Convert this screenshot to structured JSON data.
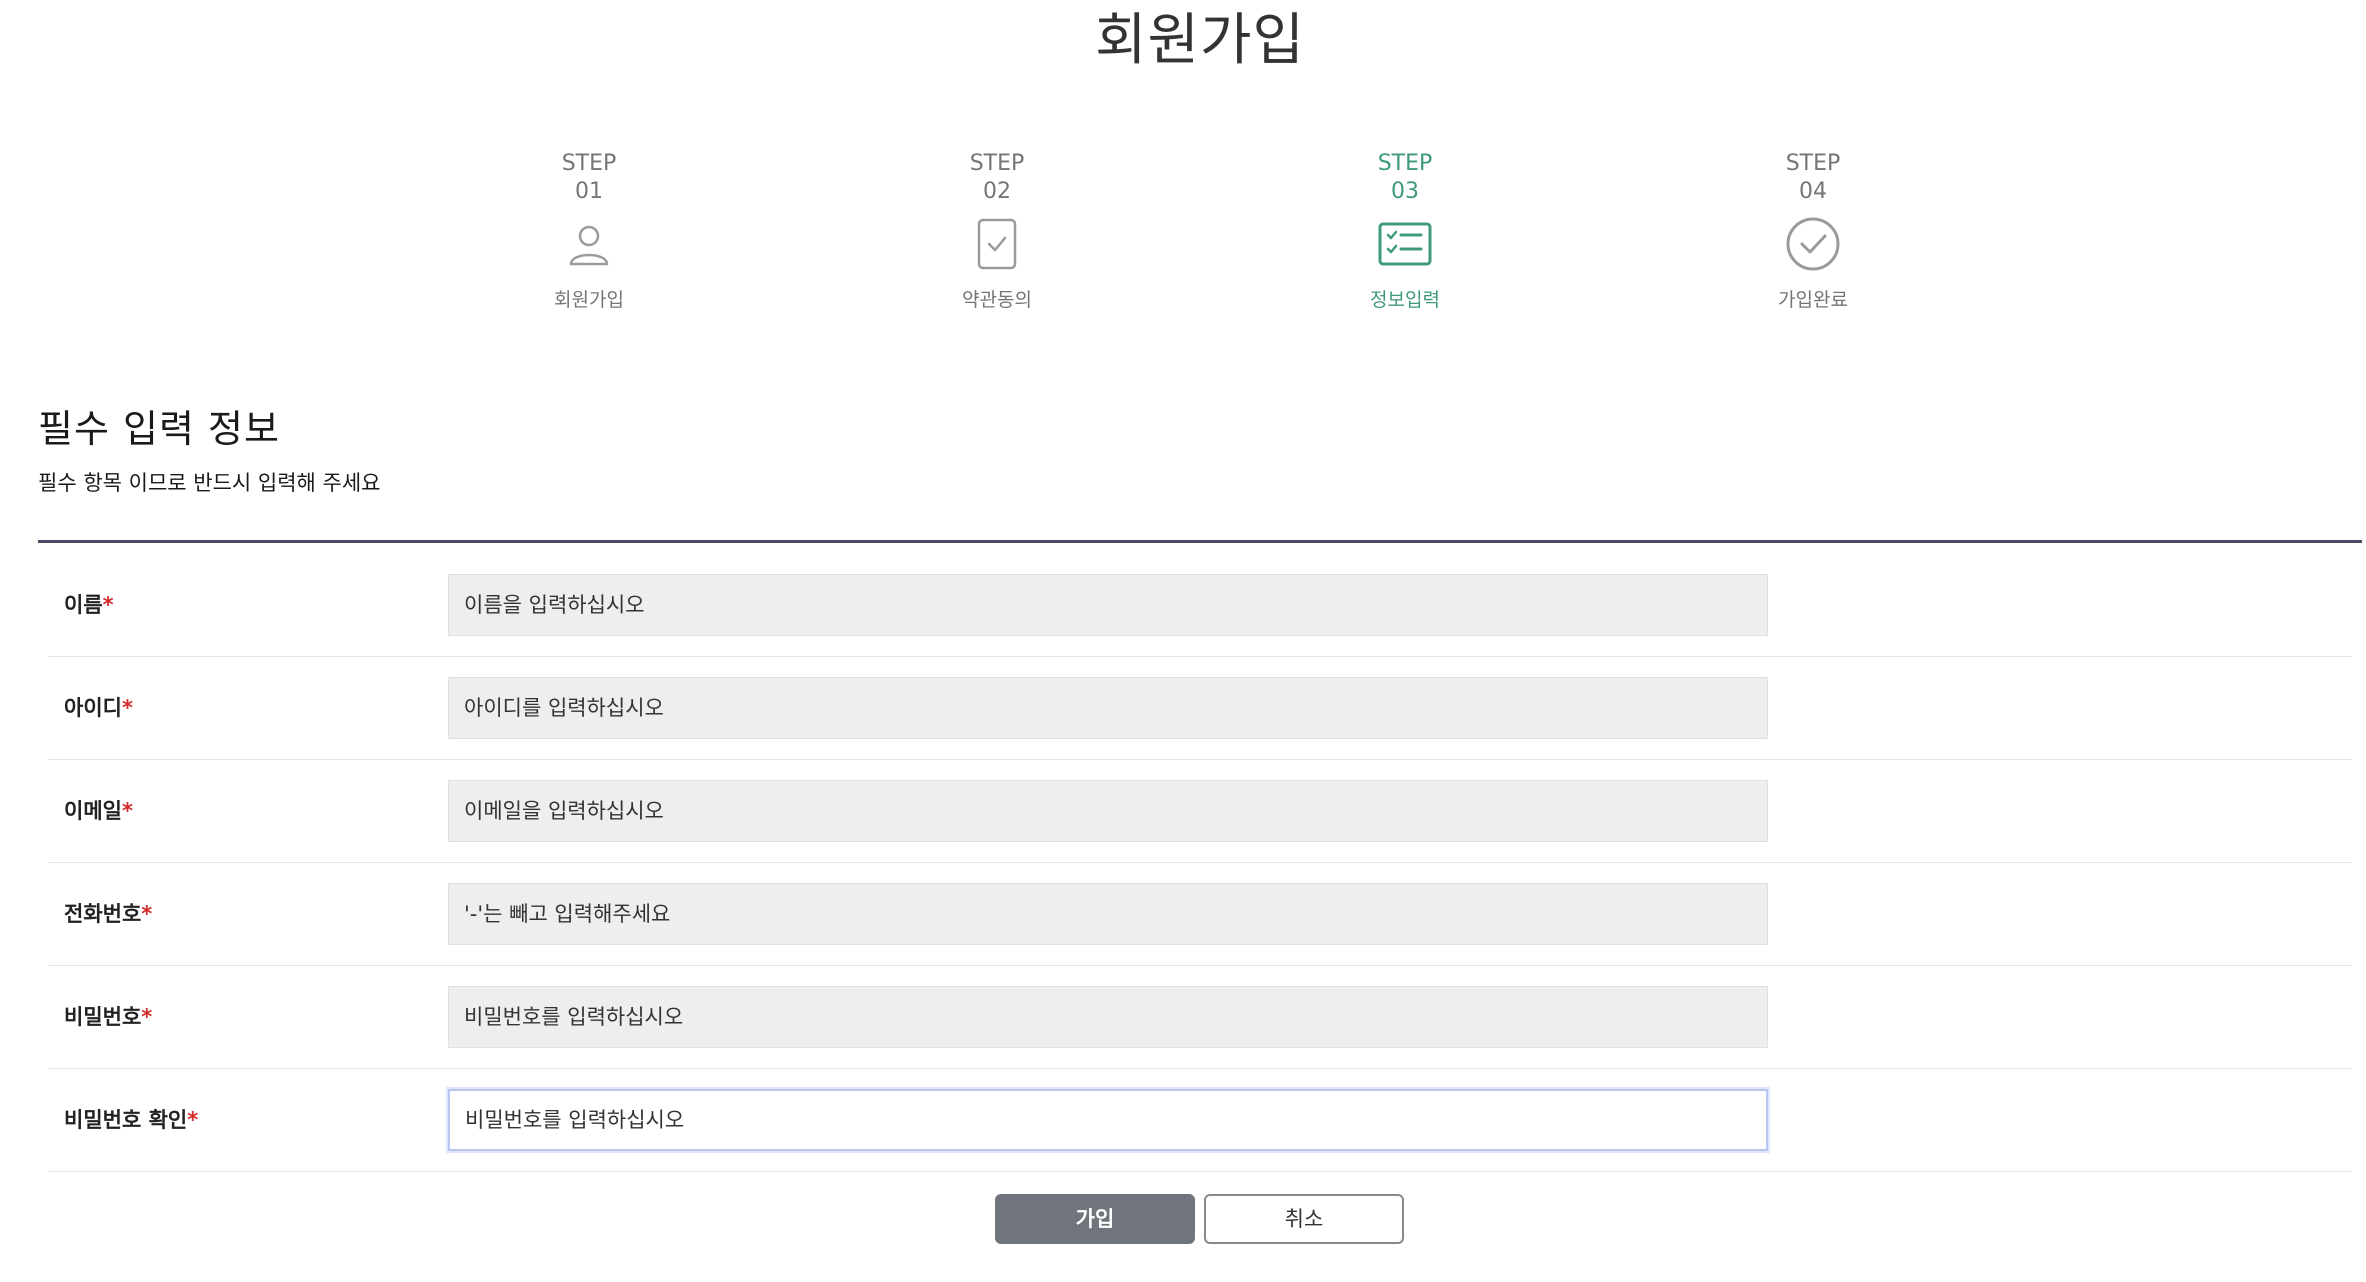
{
  "page": {
    "title": "회원가입"
  },
  "steps": [
    {
      "label": "STEP",
      "number": "01",
      "name": "회원가입",
      "icon": "person-icon",
      "active": false
    },
    {
      "label": "STEP",
      "number": "02",
      "name": "약관동의",
      "icon": "document-check-icon",
      "active": false
    },
    {
      "label": "STEP",
      "number": "03",
      "name": "정보입력",
      "icon": "checklist-form-icon",
      "active": true
    },
    {
      "label": "STEP",
      "number": "04",
      "name": "가입완료",
      "icon": "check-circle-icon",
      "active": false
    }
  ],
  "section": {
    "title": "필수 입력 정보",
    "description": "필수 항목 이므로 반드시 입력해 주세요"
  },
  "form": {
    "required_mark": "*",
    "fields": [
      {
        "label": "이름",
        "placeholder": "이름을 입력하십시오",
        "value": ""
      },
      {
        "label": "아이디",
        "placeholder": "아이디를 입력하십시오",
        "value": ""
      },
      {
        "label": "이메일",
        "placeholder": "이메일을 입력하십시오",
        "value": ""
      },
      {
        "label": "전화번호",
        "placeholder": "'-'는 빼고 입력해주세요",
        "value": ""
      },
      {
        "label": "비밀번호",
        "placeholder": "비밀번호를 입력하십시오",
        "value": ""
      },
      {
        "label": "비밀번호 확인",
        "placeholder": "비밀번호를 입력하십시오",
        "value": ""
      }
    ]
  },
  "buttons": {
    "submit_label": "가입",
    "cancel_label": "취소"
  },
  "colors": {
    "active_step": "#3f9a7a",
    "inactive_step": "#757575",
    "required_star": "#d42a2a",
    "divider": "#4b4a63",
    "submit_button": "#6f747d"
  }
}
